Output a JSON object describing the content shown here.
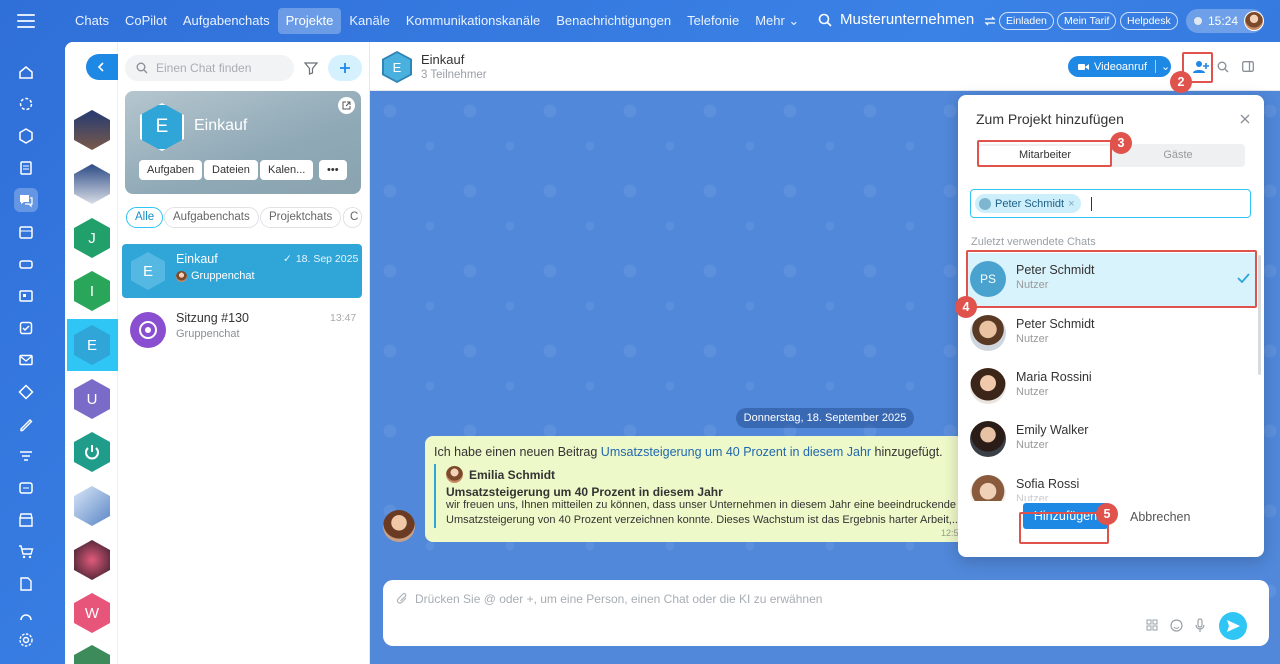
{
  "nav": {
    "items": [
      "Chats",
      "CoPilot",
      "Aufgabenchats",
      "Projekte",
      "Kanäle",
      "Kommunikationskanäle",
      "Benachrichtigungen",
      "Telefonie",
      "Mehr"
    ],
    "active_index": 3
  },
  "header": {
    "company": "Musterunternehmen",
    "invite_label": "Einladen",
    "tariff_label": "Mein Tarif",
    "helpdesk_label": "Helpdesk",
    "time": "15:24"
  },
  "chatlist": {
    "search_placeholder": "Einen Chat finden",
    "card": {
      "initial": "E",
      "title": "Einkauf",
      "buttons": [
        "Aufgaben",
        "Dateien",
        "Kalen...",
        "•••"
      ]
    },
    "filters": [
      "Alle",
      "Aufgabenchats",
      "Projektchats",
      "C"
    ],
    "items": [
      {
        "initial": "E",
        "name": "Einkauf",
        "date": "18. Sep 2025",
        "sub": "Gruppenchat"
      },
      {
        "name": "Sitzung #130",
        "date": "13:47",
        "sub": "Gruppenchat"
      }
    ]
  },
  "recent": {
    "letters": [
      "J",
      "I",
      "E",
      "U",
      "W"
    ]
  },
  "chat": {
    "initial": "E",
    "title": "Einkauf",
    "members": "3 Teilnehmer",
    "video_label": "Videoanruf",
    "date_separator": "Donnerstag, 18. September 2025",
    "message": {
      "text_before": "Ich habe einen neuen Beitrag ",
      "link": "Umsatzsteigerung um 40 Prozent in diesem Jahr",
      "text_after": " hinzugefügt.",
      "quote_author": "Emilia Schmidt",
      "quote_title": "Umsatzsteigerung um 40 Prozent in diesem Jahr",
      "quote_line1": "wir freuen uns, Ihnen mitteilen zu können, dass unser Unternehmen in diesem Jahr eine beeindruckende",
      "quote_line2": "Umsatzsteigerung von 40 Prozent verzeichnen konnte. Dieses Wachstum ist das Ergebnis harter Arbeit,...",
      "time": "12:5"
    },
    "composer_placeholder": "Drücken Sie @ oder +, um eine Person, einen Chat oder die KI zu erwähnen"
  },
  "popup": {
    "title": "Zum Projekt hinzufügen",
    "tab_employees": "Mitarbeiter",
    "tab_guests": "Gäste",
    "selected_tag": "Peter Schmidt",
    "section": "Zuletzt verwendete Chats",
    "people": [
      {
        "initials": "PS",
        "name": "Peter Schmidt",
        "role": "Nutzer"
      },
      {
        "name": "Peter Schmidt",
        "role": "Nutzer"
      },
      {
        "name": "Maria Rossini",
        "role": "Nutzer"
      },
      {
        "name": "Emily Walker",
        "role": "Nutzer"
      },
      {
        "name": "Sofia Rossi",
        "role": "Nutzer"
      }
    ],
    "add_label": "Hinzufügen",
    "cancel_label": "Abbrechen"
  },
  "badges": [
    "2",
    "3",
    "4",
    "5"
  ],
  "colors": {
    "accent": "#2fc6f6",
    "blue": "#1e88e5",
    "callout": "#e0524c"
  }
}
